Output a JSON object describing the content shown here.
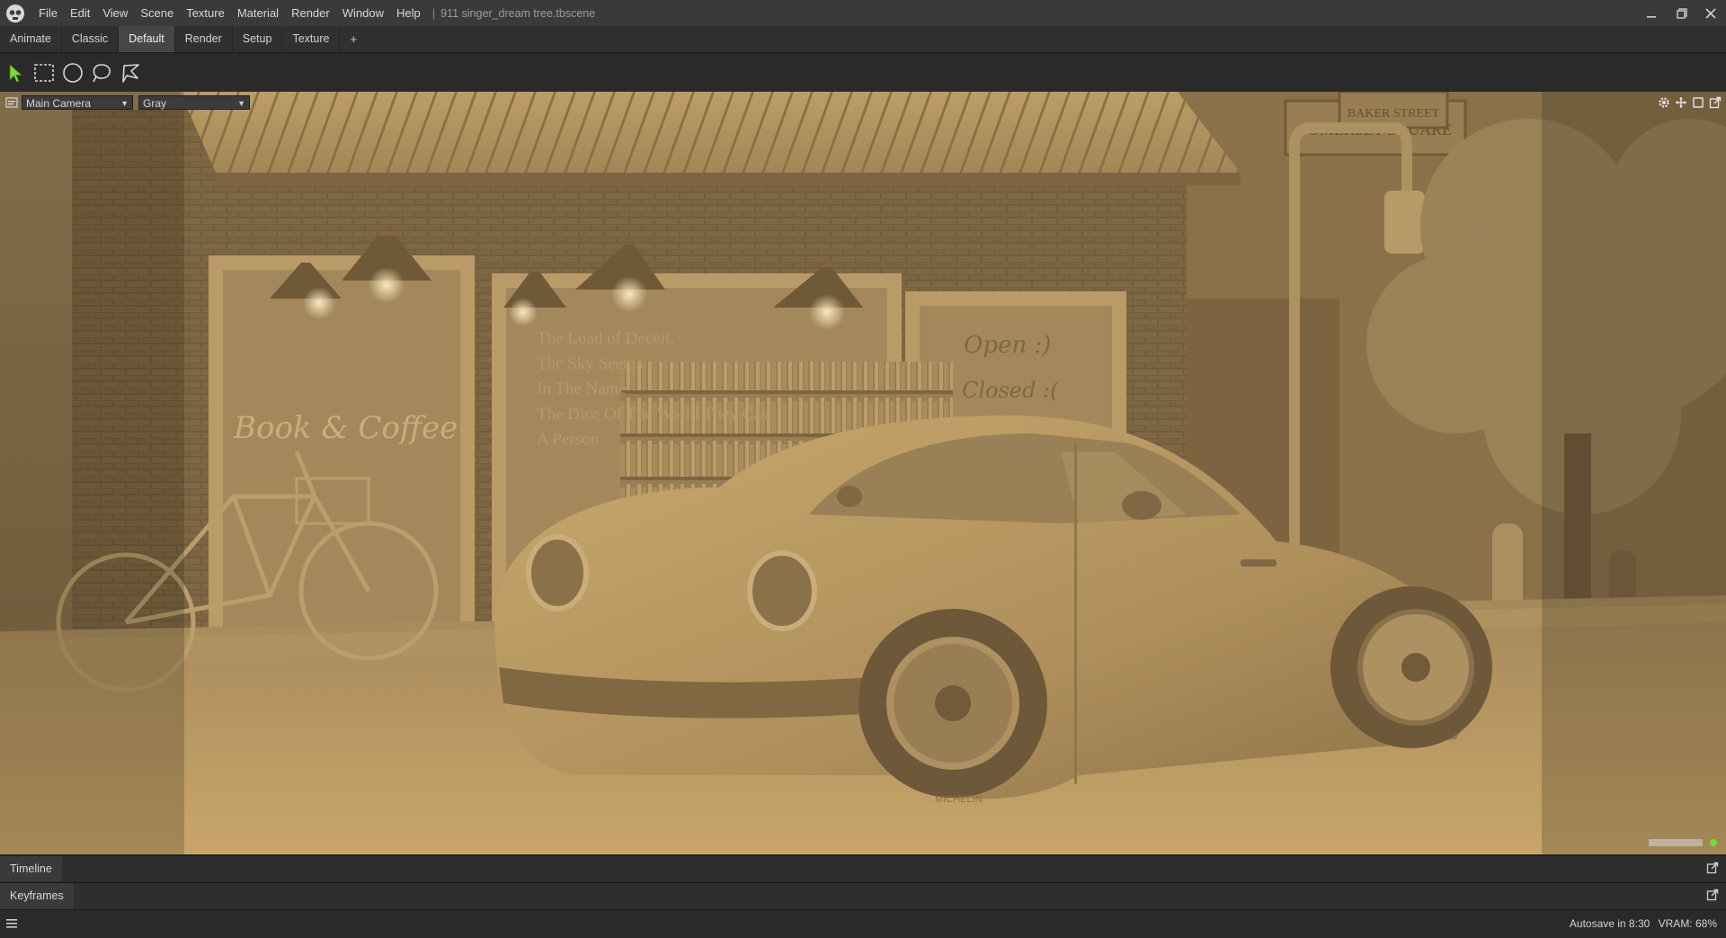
{
  "menu": {
    "items": [
      "File",
      "Edit",
      "View",
      "Scene",
      "Texture",
      "Material",
      "Render",
      "Window",
      "Help"
    ],
    "separator": "|",
    "doc_title": "911 singer_dream tree.tbscene"
  },
  "window_controls": {
    "minimize": "minimize-icon",
    "restore": "restore-icon",
    "close": "close-icon"
  },
  "layout_tabs": {
    "tabs": [
      "Animate",
      "Classic",
      "Default",
      "Render",
      "Setup",
      "Texture"
    ],
    "active": "Default",
    "add_label": "+"
  },
  "tools": [
    "select-arrow-icon",
    "rectangle-select-icon",
    "ellipse-select-icon",
    "lasso-select-icon",
    "polygon-lasso-icon"
  ],
  "viewport": {
    "camera": "Main Camera",
    "shading": "Gray",
    "scene": {
      "sign_script": "Book & Coffee",
      "window_poem": [
        "The Load of Deceit,",
        "The Sky Seems",
        "In The Name",
        "The Dice Of The World They Cast",
        "A Person"
      ],
      "door_note_open": "Open :)",
      "door_note_closed": "Closed :(",
      "street_sign_1": "SOMERSET SQUARE",
      "street_sign_2": "BAKER STREET",
      "tire_text": "MICHELIN"
    },
    "icons": [
      "gear-icon",
      "move-icon",
      "frame-icon",
      "popout-icon"
    ],
    "tint": "#d0ad6c"
  },
  "panels": {
    "timeline_label": "Timeline",
    "keyframes_label": "Keyframes"
  },
  "status": {
    "autosave": "Autosave in 8:30",
    "vram": "VRAM: 68%"
  },
  "colors": {
    "accent_green": "#7bd83a",
    "menu_bg": "#3a3a3a",
    "active_tab": "#474747"
  }
}
